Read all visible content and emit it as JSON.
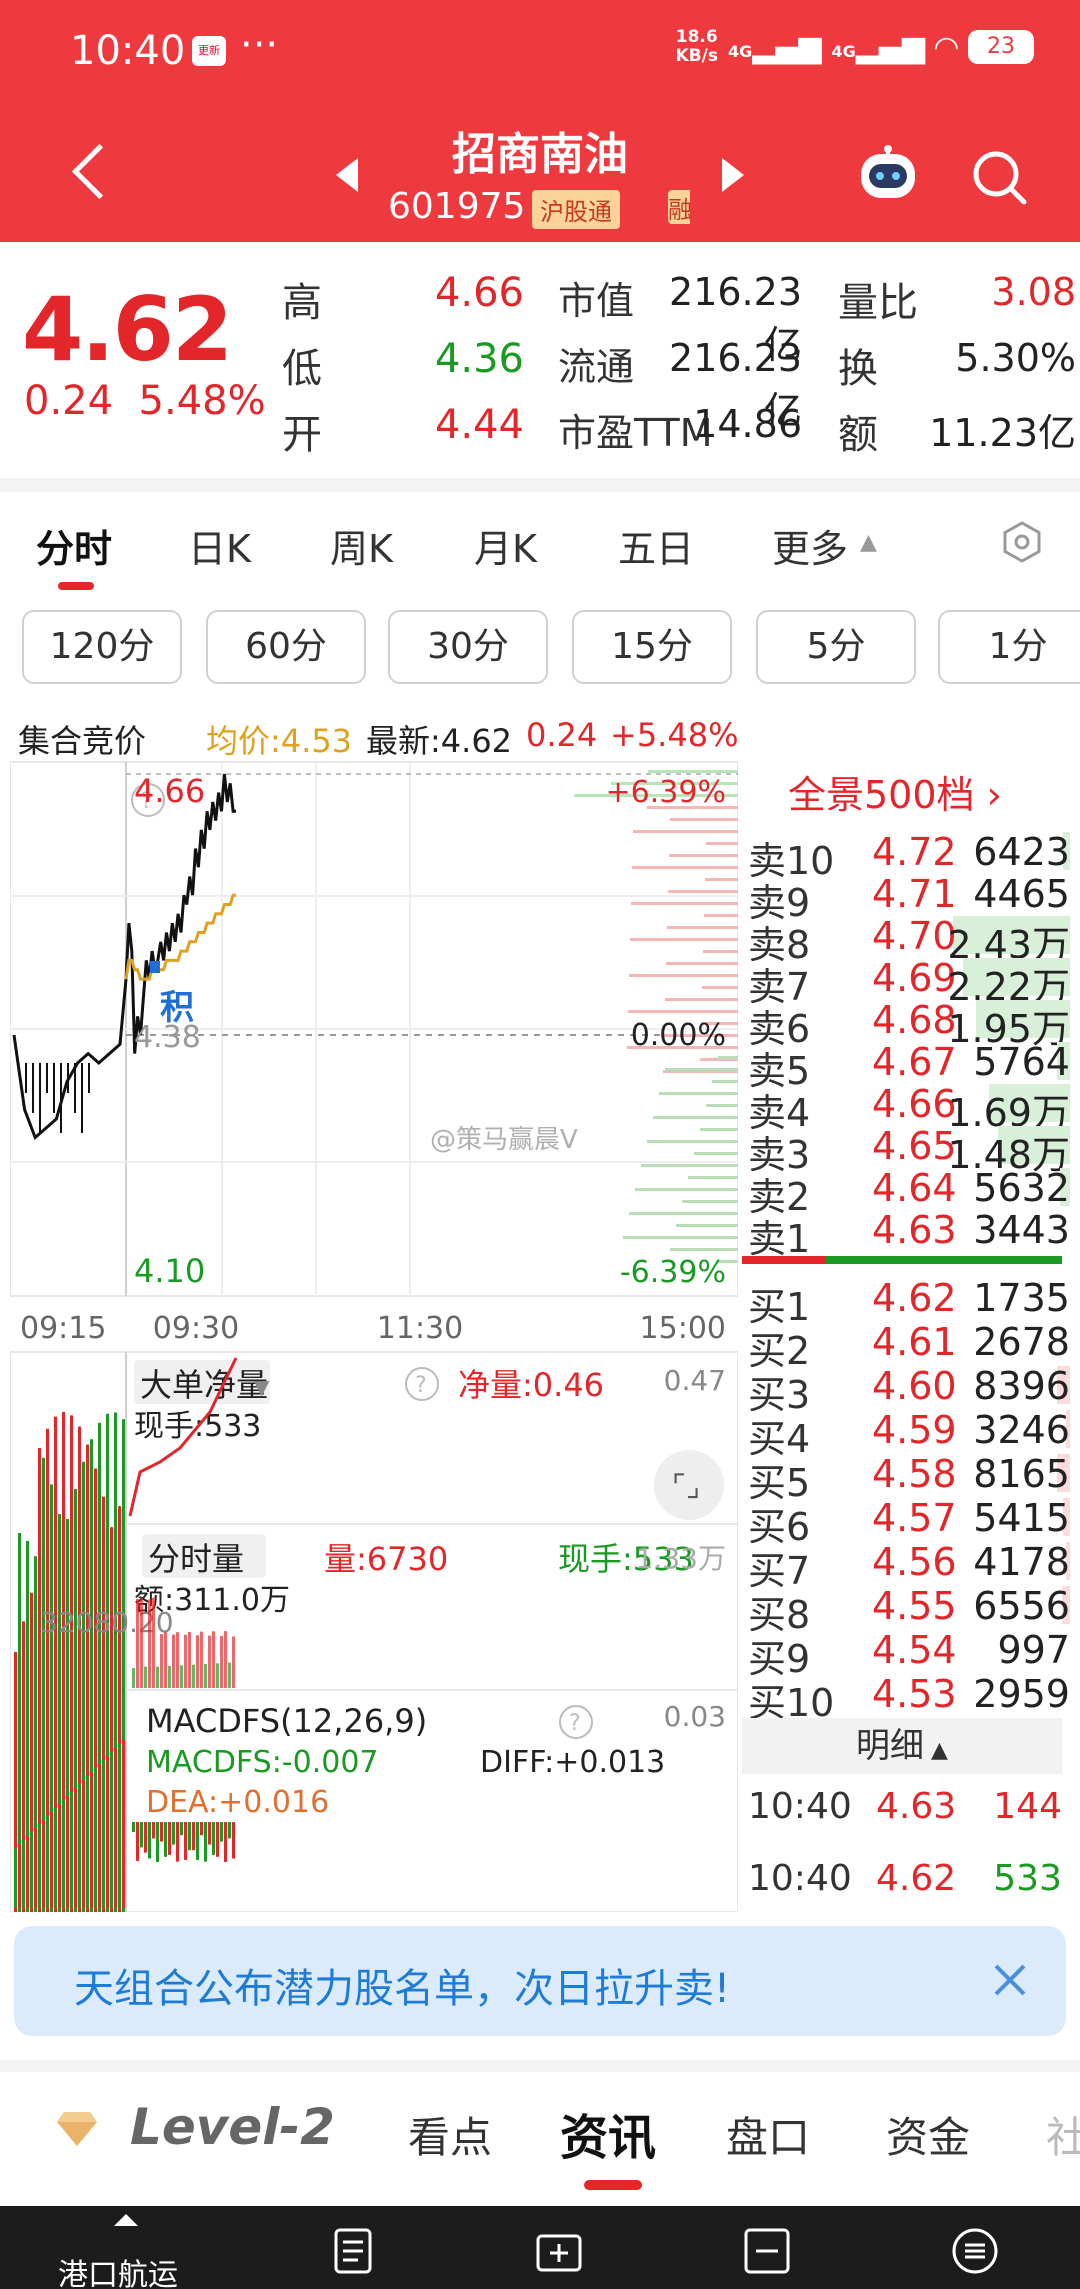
{
  "status_bar": {
    "time": "10:40",
    "app_badge": "更新",
    "dots": "···",
    "net_speed": "18.6\nKB/s",
    "net_speed_top": "18.6",
    "net_speed_bottom": "KB/s",
    "sig1": "4G",
    "sig2": "4G",
    "battery": "23"
  },
  "header": {
    "stock_name": "招商南油",
    "stock_code": "601975",
    "badge": "沪股通",
    "badge_more": "融"
  },
  "quote": {
    "price": "4.62",
    "change": "0.24",
    "change_pct": "5.48%",
    "rows": [
      {
        "l1": "高",
        "v1": "4.66",
        "c1": "red",
        "l2": "市值",
        "v2": "216.23亿",
        "l3": "量比",
        "v3": "3.08",
        "c3": "red"
      },
      {
        "l1": "低",
        "v1": "4.36",
        "c1": "green",
        "l2": "流通",
        "v2": "216.23亿",
        "l3": "换",
        "v3": "5.30%",
        "c3": "blk"
      },
      {
        "l1": "开",
        "v1": "4.44",
        "c1": "red",
        "l2": "市盈TTM",
        "v2": "14.86",
        "l3": "额",
        "v3": "11.23亿",
        "c3": "blk"
      }
    ]
  },
  "tabs": [
    "分时",
    "日K",
    "周K",
    "月K",
    "五日",
    "更多"
  ],
  "periods": [
    "120分",
    "60分",
    "30分",
    "15分",
    "5分",
    "1分"
  ],
  "info_line": {
    "label": "集合竞价",
    "avg": "均价:4.53",
    "latest": "最新:4.62",
    "chg": "0.24",
    "pct": "+5.48%"
  },
  "chart_data": {
    "type": "line",
    "price_labels": {
      "top": "4.66",
      "mid": "4.38",
      "bottom": "4.10"
    },
    "pct_labels": {
      "top": "+6.39%",
      "mid": "0.00%",
      "bottom": "-6.39%"
    },
    "time_labels": [
      "09:15",
      "09:30",
      "11:30",
      "15:00"
    ],
    "marker": "积",
    "watermark": "@策马赢晨V",
    "x": [
      "09:15",
      "09:16",
      "09:17",
      "09:18",
      "09:19",
      "09:20",
      "09:21",
      "09:22",
      "09:23",
      "09:24",
      "09:25",
      "09:30",
      "09:31",
      "09:32",
      "09:33",
      "09:34",
      "09:35",
      "09:36",
      "09:37",
      "09:38",
      "09:39",
      "09:40",
      "09:41",
      "09:42",
      "09:43",
      "09:44",
      "09:45",
      "09:46",
      "09:47",
      "09:48",
      "09:49",
      "09:50",
      "09:51",
      "09:52",
      "09:53",
      "09:54",
      "09:55",
      "09:56",
      "09:57",
      "09:58",
      "09:59",
      "10:00",
      "10:05",
      "10:10",
      "10:15",
      "10:20",
      "10:25",
      "10:30",
      "10:35",
      "10:40"
    ],
    "price": [
      4.38,
      4.3,
      4.27,
      4.28,
      4.29,
      4.33,
      4.35,
      4.36,
      4.35,
      4.36,
      4.37,
      4.44,
      4.5,
      4.47,
      4.36,
      4.4,
      4.38,
      4.42,
      4.46,
      4.44,
      4.47,
      4.45,
      4.46,
      4.48,
      4.46,
      4.49,
      4.47,
      4.5,
      4.48,
      4.51,
      4.49,
      4.53,
      4.52,
      4.55,
      4.53,
      4.58,
      4.56,
      4.6,
      4.58,
      4.62,
      4.6,
      4.63,
      4.61,
      4.64,
      4.62,
      4.66,
      4.63,
      4.65,
      4.62,
      4.62
    ],
    "avg": [
      null,
      null,
      null,
      null,
      null,
      null,
      null,
      null,
      null,
      null,
      null,
      4.44,
      4.46,
      4.46,
      4.45,
      4.45,
      4.44,
      4.44,
      4.44,
      4.44,
      4.45,
      4.45,
      4.45,
      4.45,
      4.45,
      4.46,
      4.46,
      4.46,
      4.46,
      4.46,
      4.47,
      4.47,
      4.47,
      4.48,
      4.48,
      4.48,
      4.49,
      4.49,
      4.49,
      4.5,
      4.5,
      4.5,
      4.51,
      4.51,
      4.51,
      4.52,
      4.52,
      4.52,
      4.53,
      4.53
    ]
  },
  "panels": {
    "big_order": {
      "title": "大单净量",
      "net": "净量:0.46",
      "cur": "现手:533",
      "right": "0.47"
    },
    "volume": {
      "title": "分时量",
      "vol": "量:6730",
      "cur": "现手:533",
      "amount": "额:311.0万",
      "right": "1.33万",
      "left_val": "32080.20"
    },
    "macd": {
      "title": "MACDFS(12,26,9)",
      "macd": "MACDFS:-0.007",
      "diff": "DIFF:+0.013",
      "dea": "DEA:+0.016",
      "right": "0.03"
    }
  },
  "order_book": {
    "panorama": "全景500档",
    "asks": [
      {
        "label": "卖10",
        "price": "4.72",
        "vol": "6423",
        "bar": 0.05
      },
      {
        "label": "卖9",
        "price": "4.71",
        "vol": "4465",
        "bar": 0.0
      },
      {
        "label": "卖8",
        "price": "4.70",
        "vol": "2.43万",
        "bar": 0.9
      },
      {
        "label": "卖7",
        "price": "4.69",
        "vol": "2.22万",
        "bar": 0.82
      },
      {
        "label": "卖6",
        "price": "4.68",
        "vol": "1.95万",
        "bar": 0.72
      },
      {
        "label": "卖5",
        "price": "4.67",
        "vol": "5764",
        "bar": 0.1
      },
      {
        "label": "卖4",
        "price": "4.66",
        "vol": "1.69万",
        "bar": 0.62
      },
      {
        "label": "卖3",
        "price": "4.65",
        "vol": "1.48万",
        "bar": 0.55
      },
      {
        "label": "卖2",
        "price": "4.64",
        "vol": "5632",
        "bar": 0.08
      },
      {
        "label": "卖1",
        "price": "4.63",
        "vol": "3443",
        "bar": 0.0
      }
    ],
    "bids": [
      {
        "label": "买1",
        "price": "4.62",
        "vol": "1735",
        "bar": 0.0
      },
      {
        "label": "买2",
        "price": "4.61",
        "vol": "2678",
        "bar": 0.0
      },
      {
        "label": "买3",
        "price": "4.60",
        "vol": "8396",
        "bar": 0.1
      },
      {
        "label": "买4",
        "price": "4.59",
        "vol": "3246",
        "bar": 0.03
      },
      {
        "label": "买5",
        "price": "4.58",
        "vol": "8165",
        "bar": 0.1
      },
      {
        "label": "买6",
        "price": "4.57",
        "vol": "5415",
        "bar": 0.05
      },
      {
        "label": "买7",
        "price": "4.56",
        "vol": "4178",
        "bar": 0.03
      },
      {
        "label": "买8",
        "price": "4.55",
        "vol": "6556",
        "bar": 0.06
      },
      {
        "label": "买9",
        "price": "4.54",
        "vol": "997",
        "bar": 0.0
      },
      {
        "label": "买10",
        "price": "4.53",
        "vol": "2959",
        "bar": 0.0
      }
    ],
    "detail_label": "明细",
    "ticks": [
      {
        "time": "10:40",
        "price": "4.63",
        "vol": "144",
        "vcolor": "red"
      },
      {
        "time": "10:40",
        "price": "4.62",
        "vol": "533",
        "vcolor": "green"
      }
    ]
  },
  "banner": {
    "text": "天组合公布潜力股名单，次日拉升卖!"
  },
  "bottom_tabs": {
    "level2": "Level-2",
    "items": [
      "看点",
      "资讯",
      "盘口",
      "资金",
      "社"
    ]
  },
  "nav": {
    "label": "港口航运"
  },
  "colors": {
    "header_red": "#ee3a3e",
    "up_red": "#e2262a",
    "down_green": "#1a9a22",
    "avg_line": "#e0a020"
  }
}
